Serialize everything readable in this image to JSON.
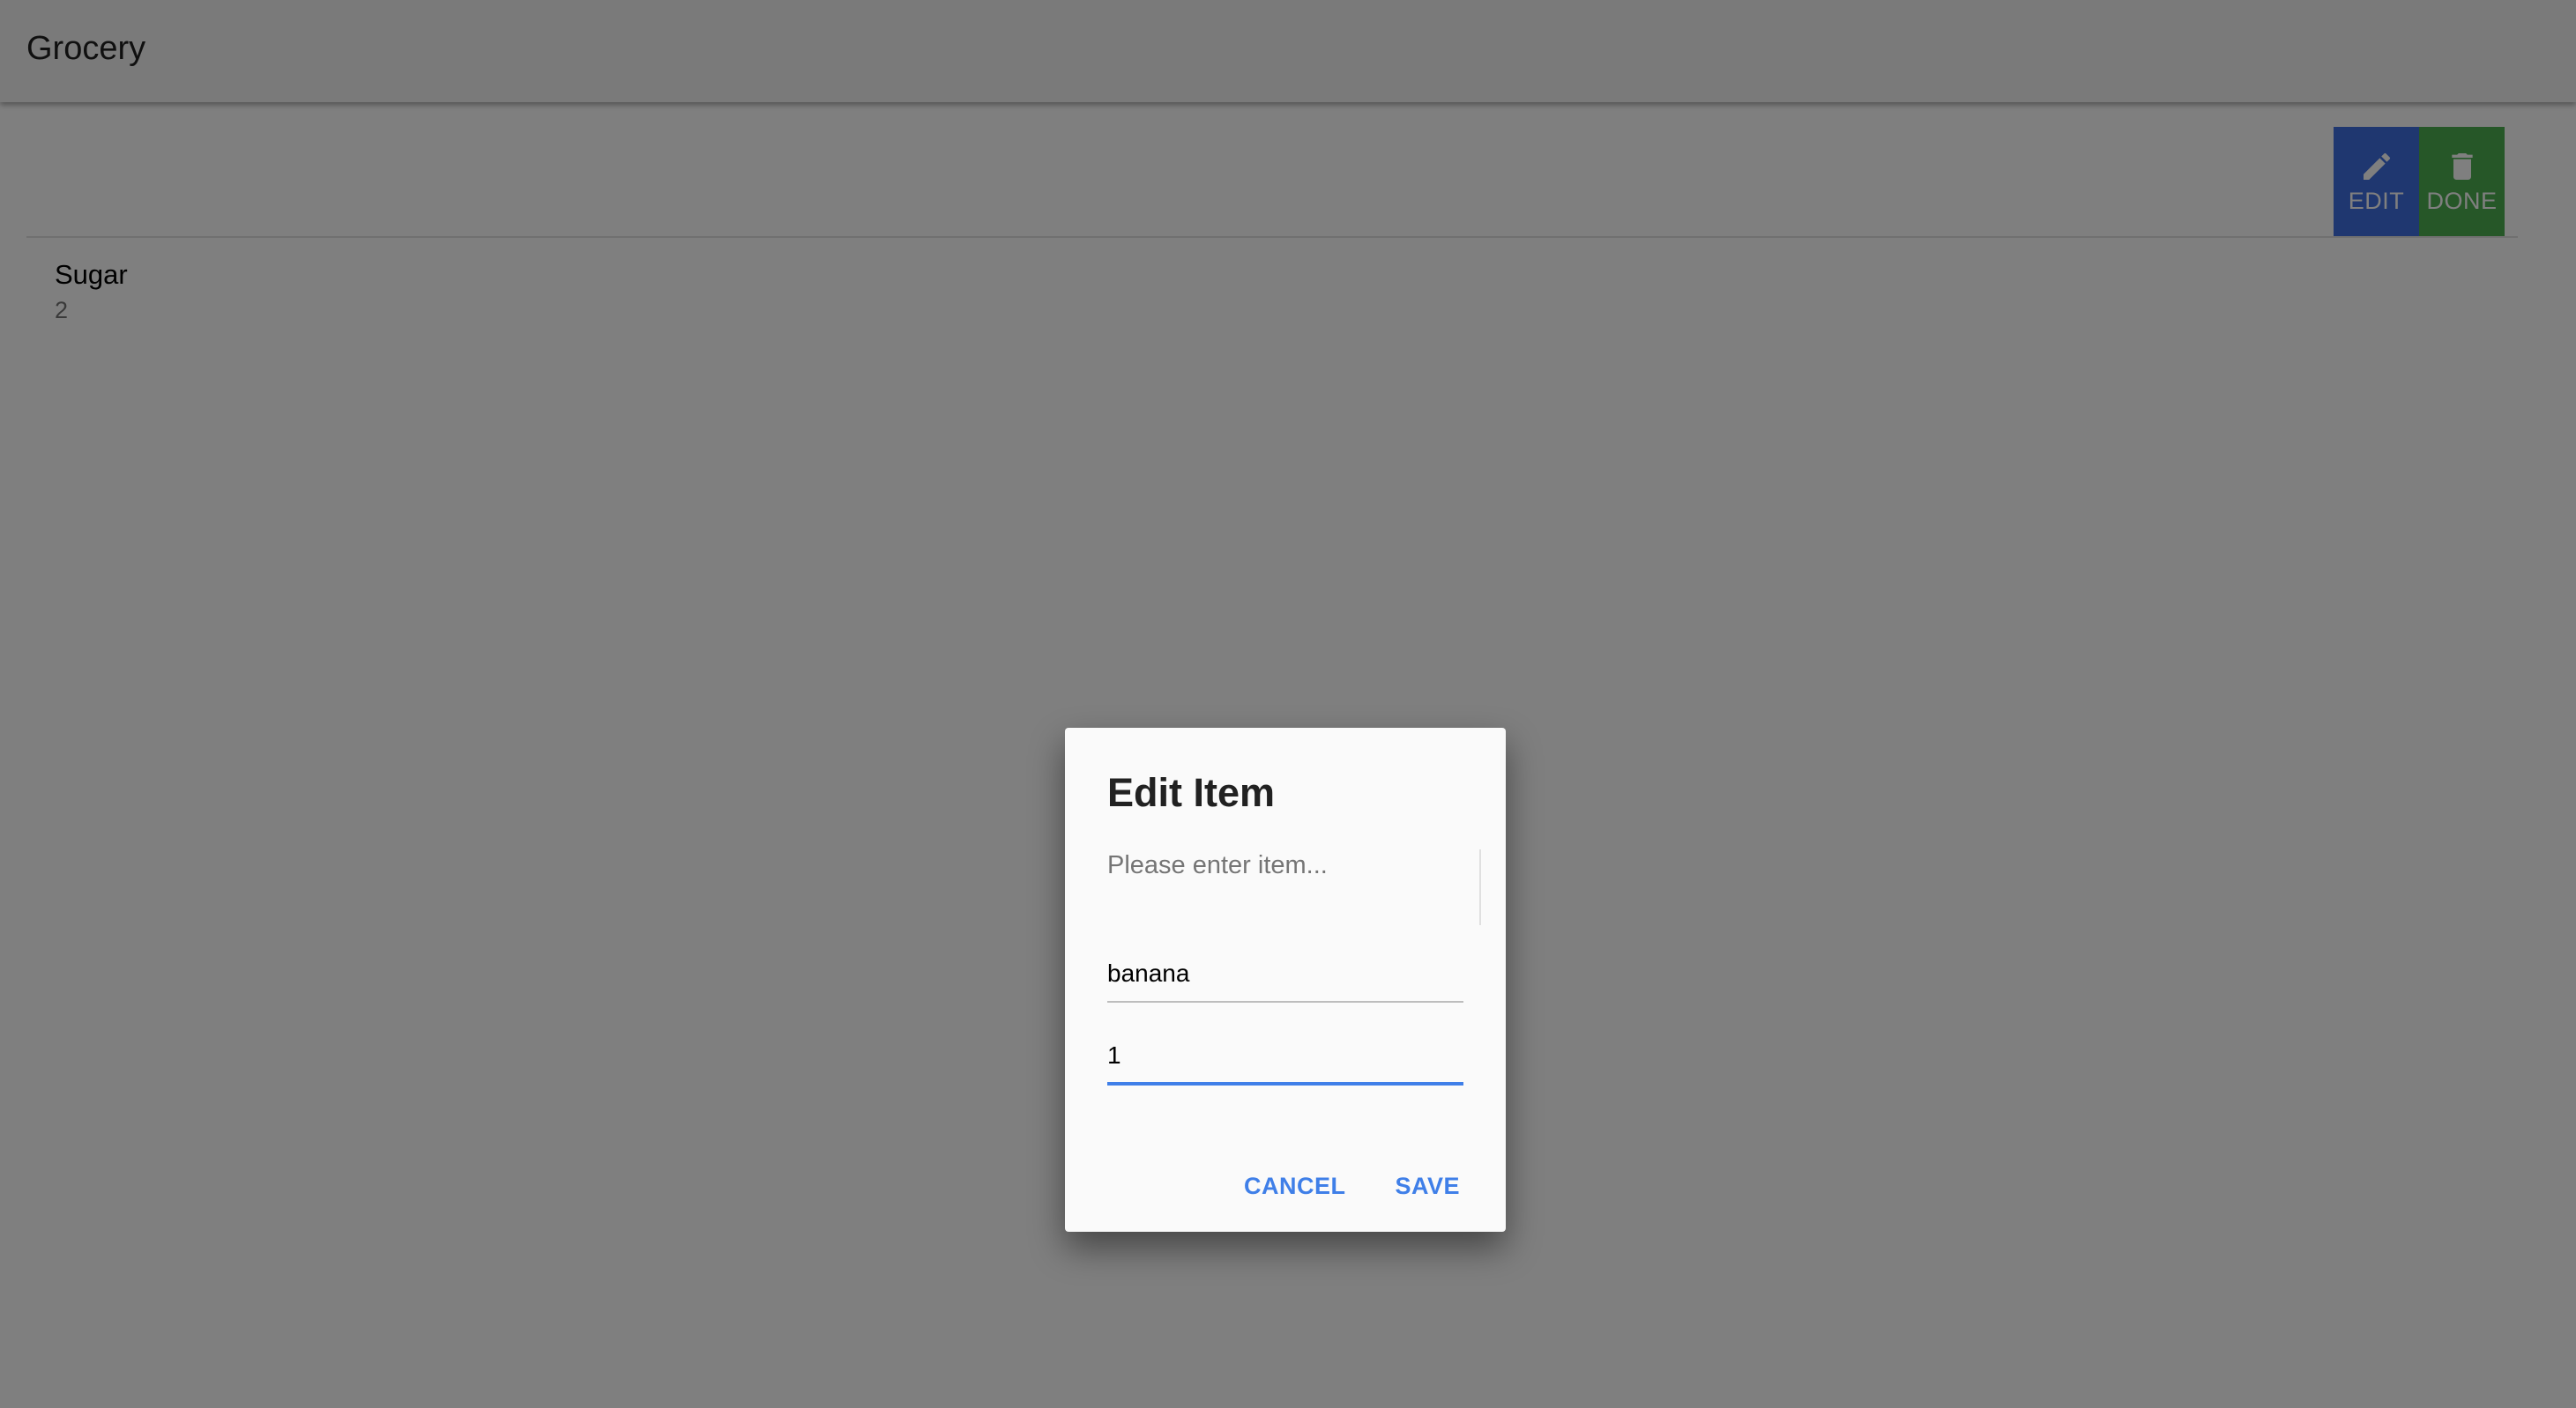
{
  "appbar": {
    "title": "Grocery"
  },
  "toolbar": {
    "edit_label": "EDIT",
    "done_label": "DONE",
    "edit_icon": "pencil-icon",
    "done_icon": "trash-icon",
    "edit_color": "#3f6fe0",
    "done_color": "#4caf50"
  },
  "items": [
    {
      "name": "Sugar",
      "quantity": "2"
    }
  ],
  "dialog": {
    "title": "Edit Item",
    "message": "Please enter item...",
    "name_value": "banana",
    "quantity_value": "1",
    "cancel_label": "CANCEL",
    "save_label": "SAVE",
    "accent_color": "#3f7fe8"
  }
}
